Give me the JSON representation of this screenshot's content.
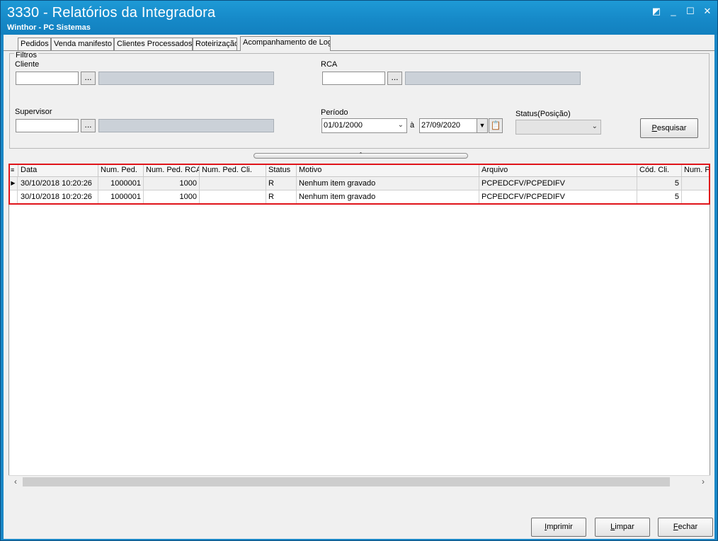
{
  "window": {
    "title": "3330 - Relatórios da Integradora",
    "subtitle": "Winthor - PC Sistemas",
    "controls": {
      "restore": "◩",
      "minimize": "_",
      "maximize": "☐",
      "close": "✕"
    }
  },
  "tabs": [
    {
      "label": "Pedidos"
    },
    {
      "label": "Venda manifesto"
    },
    {
      "label": "Clientes Processados"
    },
    {
      "label": "Roteirização"
    },
    {
      "label": "Acompanhamento de Log"
    }
  ],
  "filters": {
    "legend": "Filtros",
    "cliente_label": "Cliente",
    "cliente_value": "",
    "rca_label": "RCA",
    "rca_value": "",
    "supervisor_label": "Supervisor",
    "supervisor_value": "",
    "periodo_label": "Período",
    "periodo_start": "01/01/2000",
    "periodo_sep": "à",
    "periodo_end": "27/09/2020",
    "status_label": "Status(Posição)",
    "status_value": "",
    "dots": "...",
    "pesquisar_p": "P",
    "pesquisar_rest": "esquisar"
  },
  "grid": {
    "columns": [
      "Data",
      "Num. Ped.",
      "Num. Ped. RCA",
      "Num. Ped. Cli.",
      "Status",
      "Motivo",
      "Arquivo",
      "Cód. Cli.",
      "Num. P"
    ],
    "rows": [
      {
        "data": "30/10/2018 10:20:26",
        "num_ped": "1000001",
        "num_ped_rca": "1000",
        "num_ped_cli": "",
        "status": "R",
        "motivo": "Nenhum item gravado",
        "arquivo": "PCPEDCFV/PCPEDIFV",
        "cod_cli": "5",
        "num_p": ""
      },
      {
        "data": "30/10/2018 10:20:26",
        "num_ped": "1000001",
        "num_ped_rca": "1000",
        "num_ped_cli": "",
        "status": "R",
        "motivo": "Nenhum item gravado",
        "arquivo": "PCPEDCFV/PCPEDIFV",
        "cod_cli": "5",
        "num_p": ""
      }
    ]
  },
  "buttons": {
    "imprimir_u": "I",
    "imprimir_rest": "mprimir",
    "limpar_u": "L",
    "limpar_rest": "impar",
    "fechar_u": "F",
    "fechar_rest": "echar"
  },
  "colors": {
    "titlebar": "#1a87c6",
    "highlight": "#e0141a"
  }
}
